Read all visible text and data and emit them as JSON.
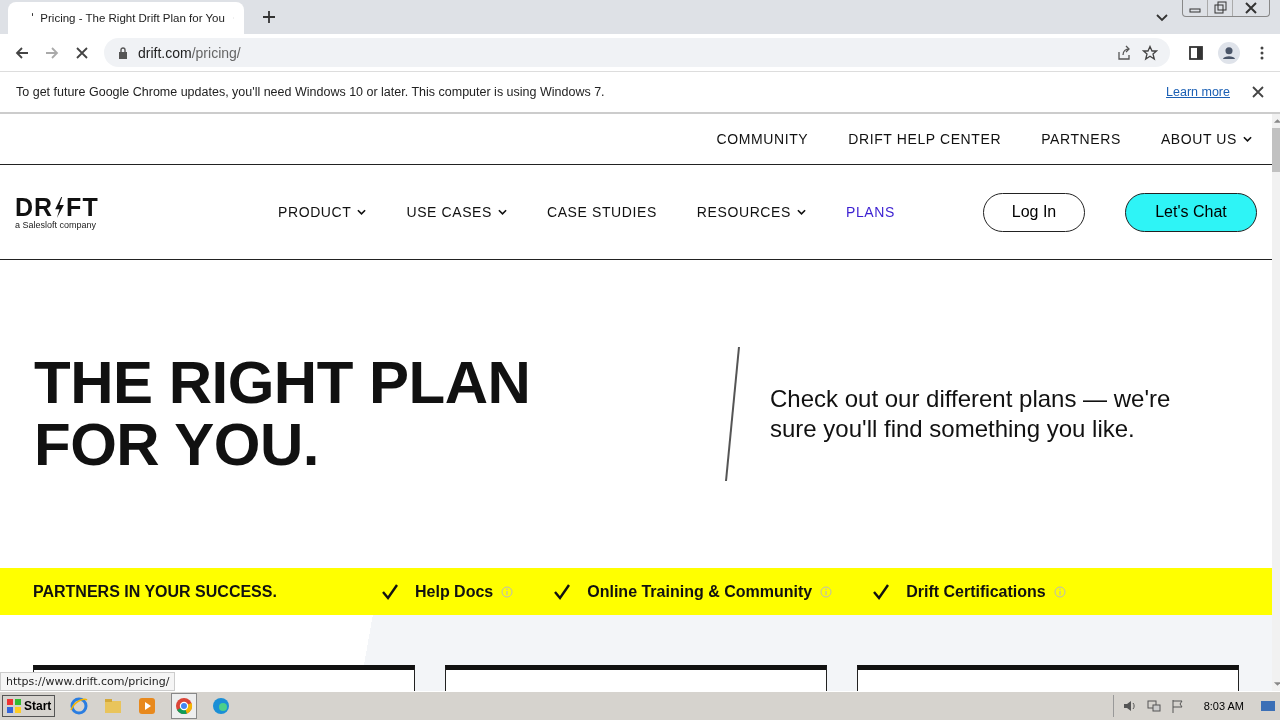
{
  "browser": {
    "tab_title": "Pricing - The Right Drift Plan for You",
    "address_domain": "drift.com",
    "address_path": "/pricing/"
  },
  "infobar": {
    "message": "To get future Google Chrome updates, you'll need Windows 10 or later. This computer is using Windows 7.",
    "link": "Learn more"
  },
  "utility_nav": [
    {
      "label": "COMMUNITY",
      "dropdown": false
    },
    {
      "label": "DRIFT HELP CENTER",
      "dropdown": false
    },
    {
      "label": "PARTNERS",
      "dropdown": false
    },
    {
      "label": "ABOUT US",
      "dropdown": true
    }
  ],
  "logo": {
    "left": "DR",
    "right": "FT",
    "tagline": "a Salesloft company"
  },
  "main_nav": [
    {
      "label": "PRODUCT",
      "dropdown": true,
      "selected": false
    },
    {
      "label": "USE CASES",
      "dropdown": true,
      "selected": false
    },
    {
      "label": "CASE STUDIES",
      "dropdown": false,
      "selected": false
    },
    {
      "label": "RESOURCES",
      "dropdown": true,
      "selected": false
    },
    {
      "label": "PLANS",
      "dropdown": false,
      "selected": true
    }
  ],
  "buttons": {
    "login": "Log In",
    "chat": "Let's Chat"
  },
  "hero": {
    "title_lines": [
      "THE RIGHT PLAN",
      "FOR YOU."
    ],
    "subtitle": "Check out our different plans — we're sure you'll find something you like."
  },
  "band": {
    "heading": "PARTNERS IN YOUR SUCCESS.",
    "items": [
      {
        "label": "Help Docs"
      },
      {
        "label": "Online Training & Community"
      },
      {
        "label": "Drift Certifications"
      }
    ]
  },
  "status_url": "https://www.drift.com/pricing/",
  "taskbar": {
    "start": "Start",
    "clock": "8:03 AM"
  }
}
